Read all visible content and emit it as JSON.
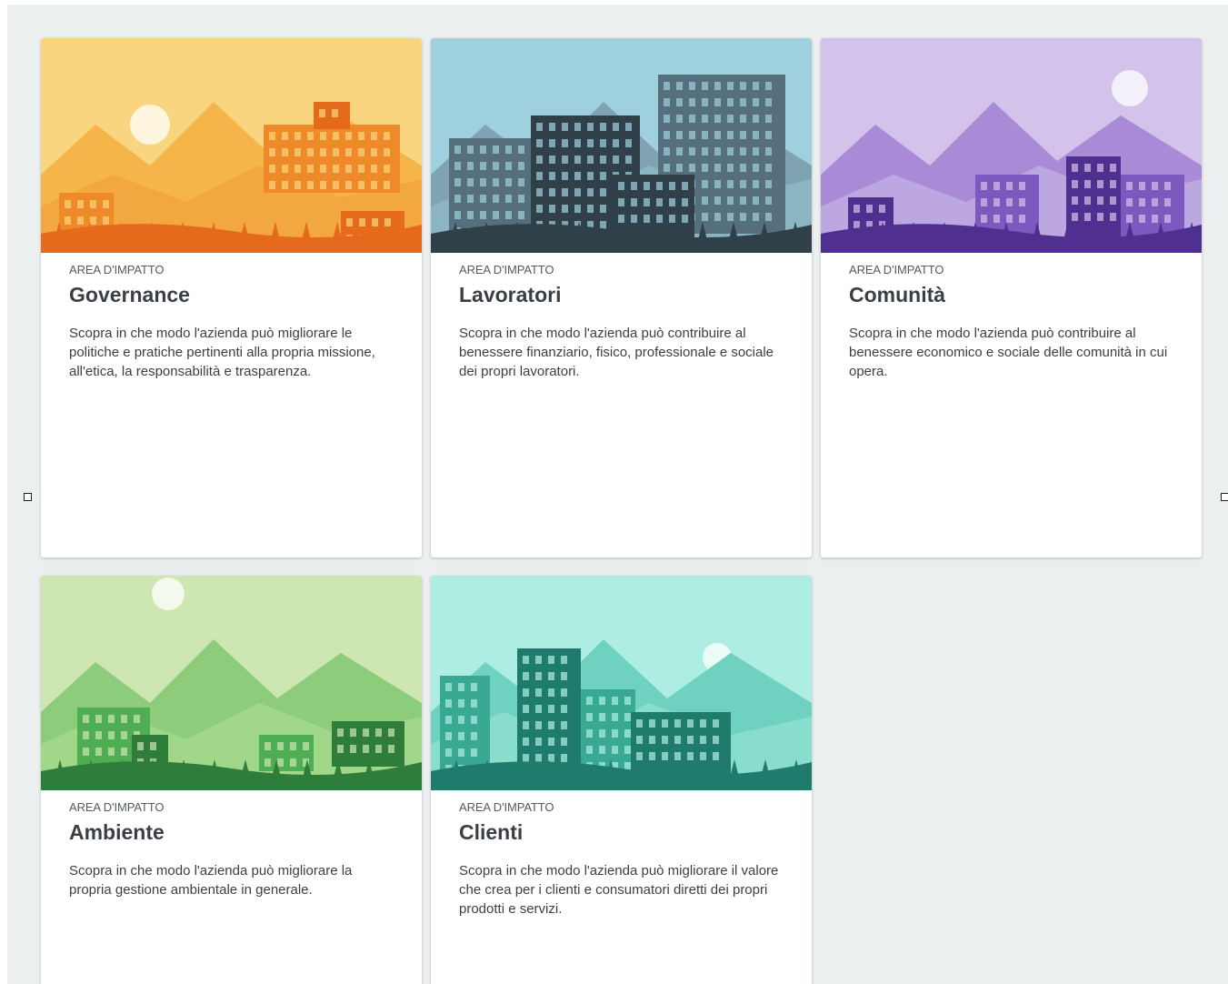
{
  "cards": [
    {
      "eyebrow": "AREA D'IMPATTO",
      "title": "Governance",
      "description": "Scopra in che modo l'azienda può migliorare le politiche e pratiche pertinenti alla propria missione, all'etica, la responsabilità e trasparenza.",
      "theme": {
        "sky": "#f8d57e",
        "far": "#f6b54a",
        "mid": "#ee8a2a",
        "near": "#e56a1c",
        "accent": "#f3a43e"
      }
    },
    {
      "eyebrow": "AREA D'IMPATTO",
      "title": "Lavoratori",
      "description": "Scopra in che modo l'azienda può contribuire al benessere finanziario, fisico, professionale e sociale dei propri lavoratori.",
      "theme": {
        "sky": "#9fd0de",
        "far": "#7fa3b2",
        "mid": "#55707c",
        "near": "#2f4048",
        "accent": "#8fb9c6"
      }
    },
    {
      "eyebrow": "AREA D'IMPATTO",
      "title": "Comunità",
      "description": "Scopra in che modo l'azienda può contribuire al benessere economico e sociale delle comunità in cui opera.",
      "theme": {
        "sky": "#d3c2ea",
        "far": "#a98ad6",
        "mid": "#7c58bf",
        "near": "#4f2f8f",
        "accent": "#c2aee3"
      }
    },
    {
      "eyebrow": "AREA D'IMPATTO",
      "title": "Ambiente",
      "description": "Scopra in che modo l'azienda può migliorare la propria gestione ambientale in generale.",
      "theme": {
        "sky": "#cde6b2",
        "far": "#8ccc7a",
        "mid": "#4fae53",
        "near": "#2f7d3a",
        "accent": "#a6d98c"
      }
    },
    {
      "eyebrow": "AREA D'IMPATTO",
      "title": "Clienti",
      "description": "Scopra in che modo l'azienda può migliorare il valore che crea per i clienti e consumatori diretti dei propri prodotti e servizi.",
      "theme": {
        "sky": "#aeeee2",
        "far": "#6fd1bf",
        "mid": "#3aa993",
        "near": "#1f7c6c",
        "accent": "#8fe0d0"
      }
    }
  ]
}
